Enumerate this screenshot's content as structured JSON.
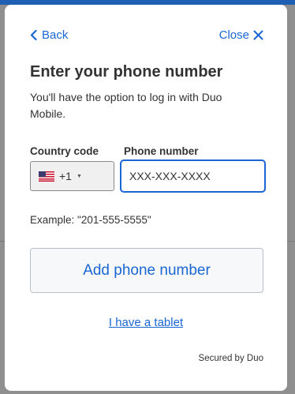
{
  "nav": {
    "back_label": "Back",
    "close_label": "Close"
  },
  "title": "Enter your phone number",
  "subtitle": "You'll have the option to log in with Duo Mobile.",
  "form": {
    "country_label": "Country code",
    "country_flag": "us-flag-icon",
    "country_code": "+1",
    "phone_label": "Phone number",
    "phone_placeholder": "XXX-XXX-XXXX",
    "phone_value": "",
    "example": "Example: \"201-555-5555\""
  },
  "add_button_label": "Add phone number",
  "tablet_link_label": "I have a tablet",
  "footer": "Secured by Duo",
  "colors": {
    "accent": "#1a66d2",
    "text": "#333333",
    "backdrop": "#8f8f8f"
  }
}
